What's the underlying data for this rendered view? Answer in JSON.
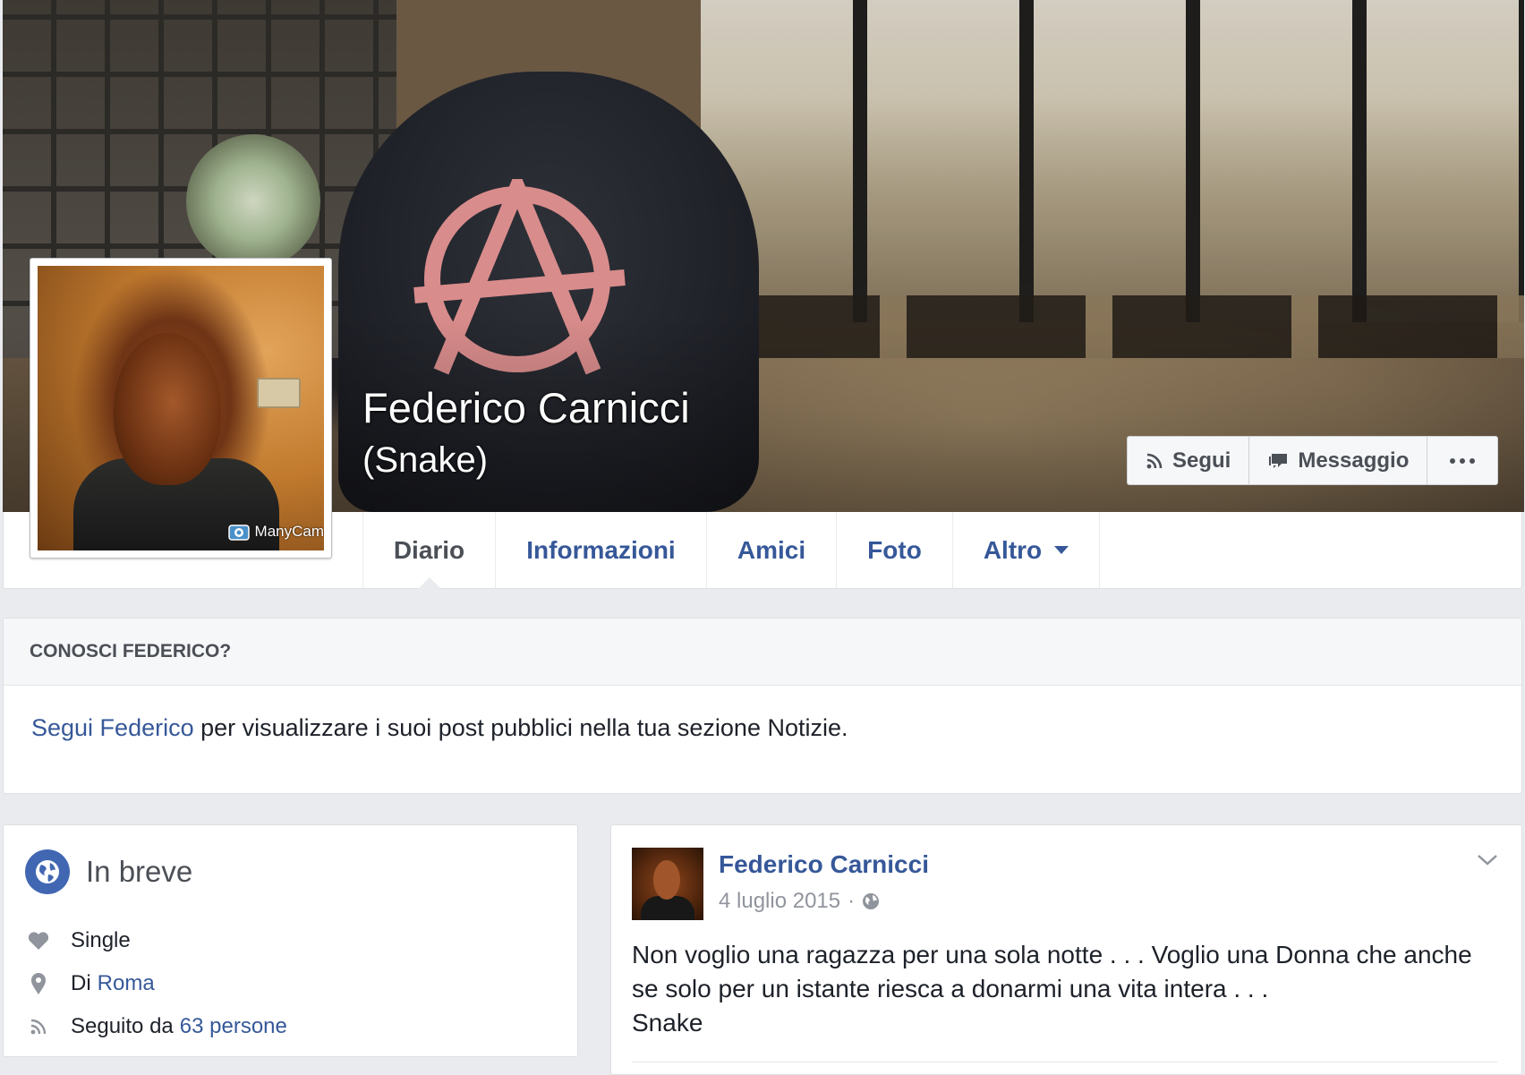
{
  "profile": {
    "name": "Federico Carnicci",
    "alternate_name": "(Snake)"
  },
  "cover_actions": [
    {
      "label": "Segui",
      "icon": "rss-icon"
    },
    {
      "label": "Messaggio",
      "icon": "message-icon"
    },
    {
      "label": "",
      "icon": "more-icon"
    }
  ],
  "avatar": {
    "watermark": "ManyCam"
  },
  "tabs": [
    "Diario",
    "Informazioni",
    "Amici",
    "Foto",
    "Altro"
  ],
  "active_tab": "Diario",
  "know_box": {
    "heading": "CONOSCI FEDERICO?",
    "link_text": "Segui Federico",
    "text": " per visualizzare i suoi post pubblici nella tua sezione Notizie."
  },
  "intro": {
    "title": "In breve",
    "rows": [
      {
        "icon": "heart-icon",
        "text": "Single",
        "link": ""
      },
      {
        "icon": "location-pin-icon",
        "text": "Di",
        "link": "Roma"
      },
      {
        "icon": "rss-icon",
        "text": "Seguito da",
        "link": "63 persone"
      }
    ]
  },
  "post": {
    "author": "Federico Carnicci",
    "date": "4 luglio 2015",
    "separator": "·",
    "audience_icon": "globe-icon",
    "lines": [
      "Non voglio una ragazza per una sola notte . . . Voglio una Donna che anche",
      "se solo per un istante riesca a donarmi una vita intera . . .",
      "Snake"
    ]
  },
  "colors": {
    "link": "#365899",
    "background": "#e9ebee",
    "accent": "#4267b2"
  }
}
